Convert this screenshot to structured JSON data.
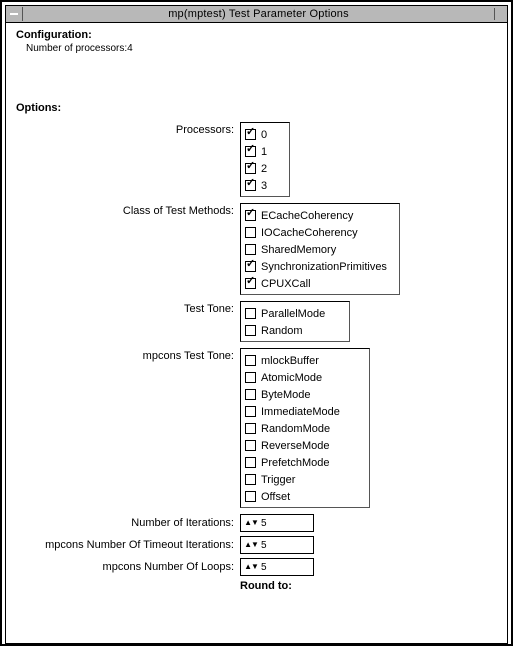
{
  "window": {
    "title": "mp(mptest) Test Parameter Options"
  },
  "configuration": {
    "heading": "Configuration:",
    "line": "Number of processors:4"
  },
  "options_heading": "Options:",
  "rows": {
    "processors": {
      "label": "Processors:",
      "items": [
        {
          "label": "0",
          "checked": true
        },
        {
          "label": "1",
          "checked": true
        },
        {
          "label": "2",
          "checked": true
        },
        {
          "label": "3",
          "checked": true
        }
      ]
    },
    "class_of_test_methods": {
      "label": "Class of Test Methods:",
      "items": [
        {
          "label": "ECacheCoherency",
          "checked": true
        },
        {
          "label": "IOCacheCoherency",
          "checked": false
        },
        {
          "label": "SharedMemory",
          "checked": false
        },
        {
          "label": "SynchronizationPrimitives",
          "checked": true
        },
        {
          "label": "CPUXCall",
          "checked": true
        }
      ]
    },
    "test_tone": {
      "label": "Test Tone:",
      "items": [
        {
          "label": "ParallelMode",
          "checked": false
        },
        {
          "label": "Random",
          "checked": false
        }
      ]
    },
    "mpcons_test_tone": {
      "label": "mpcons Test Tone:",
      "items": [
        {
          "label": "mlockBuffer",
          "checked": false
        },
        {
          "label": "AtomicMode",
          "checked": false
        },
        {
          "label": "ByteMode",
          "checked": false
        },
        {
          "label": "ImmediateMode",
          "checked": false
        },
        {
          "label": "RandomMode",
          "checked": false
        },
        {
          "label": "ReverseMode",
          "checked": false
        },
        {
          "label": "PrefetchMode",
          "checked": false
        },
        {
          "label": "Trigger",
          "checked": false
        },
        {
          "label": "Offset",
          "checked": false
        }
      ]
    },
    "number_of_iterations": {
      "label": "Number of Iterations:",
      "value": "5"
    },
    "mpcons_timeout_iterations": {
      "label": "mpcons Number Of Timeout Iterations:",
      "value": "5"
    },
    "mpcons_loops": {
      "label": "mpcons Number Of Loops:",
      "value": "5"
    },
    "round_to": "Round to:"
  },
  "glyphs": {
    "up": "▲",
    "down": "▼"
  }
}
